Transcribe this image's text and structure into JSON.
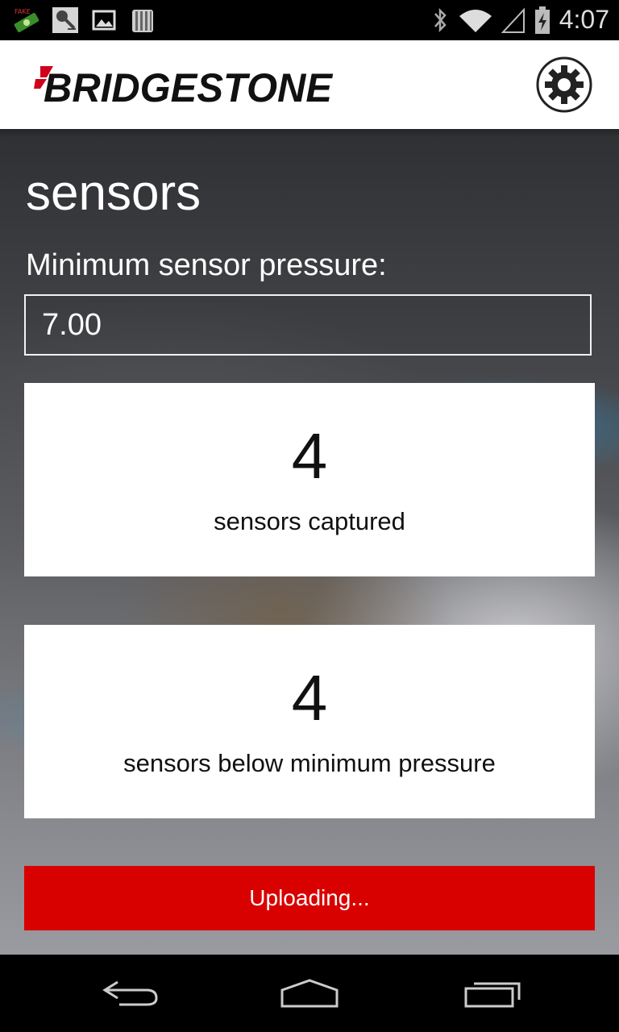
{
  "status_bar": {
    "time": "4:07",
    "left_icons": [
      "fake-gps-icon",
      "microphone-icon",
      "image-icon",
      "barcode-icon"
    ],
    "right_icons": [
      "bluetooth-icon",
      "wifi-icon",
      "signal-icon",
      "battery-charging-icon"
    ]
  },
  "app_bar": {
    "logo_text": "BRIDGESTONE",
    "settings_icon": "gear-icon"
  },
  "page": {
    "title": "sensors",
    "min_pressure_label": "Minimum sensor pressure:",
    "min_pressure_value": "7.00"
  },
  "cards": [
    {
      "count": "4",
      "label": "sensors captured"
    },
    {
      "count": "4",
      "label": "sensors below minimum pressure"
    }
  ],
  "upload_button": {
    "label": "Uploading..."
  },
  "nav_bar": {
    "icons": [
      "back-icon",
      "home-icon",
      "recent-apps-icon"
    ]
  },
  "colors": {
    "accent_red": "#d90000",
    "brand_red": "#d0021b",
    "card_bg": "#ffffff"
  }
}
